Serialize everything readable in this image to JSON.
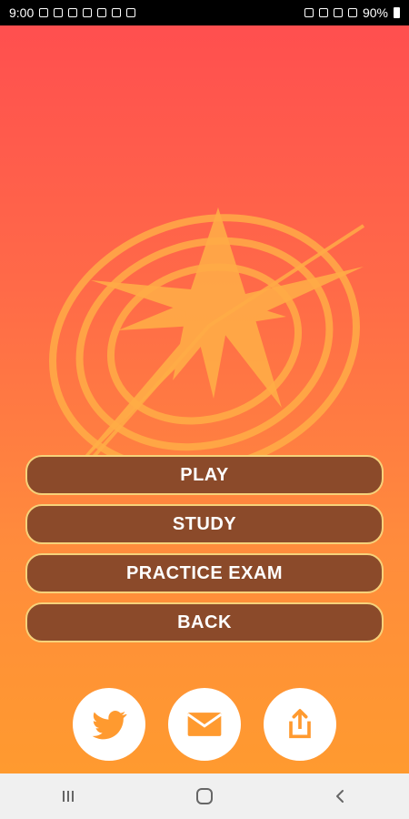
{
  "status_bar": {
    "time": "9:00",
    "battery": "90%"
  },
  "menu": {
    "play": "PLAY",
    "study": "STUDY",
    "practice_exam": "PRACTICE EXAM",
    "back": "BACK"
  },
  "social": {
    "items": [
      "twitter-icon",
      "mail-icon",
      "share-icon"
    ]
  },
  "nav": {
    "items": [
      "recent-apps-icon",
      "home-icon",
      "back-icon"
    ]
  },
  "colors": {
    "gradient_top": "#ff4f4f",
    "gradient_bottom": "#ff9a2f",
    "button_bg": "#8b4a2a",
    "button_border": "#f6d27a",
    "compass": "#ffb347"
  }
}
